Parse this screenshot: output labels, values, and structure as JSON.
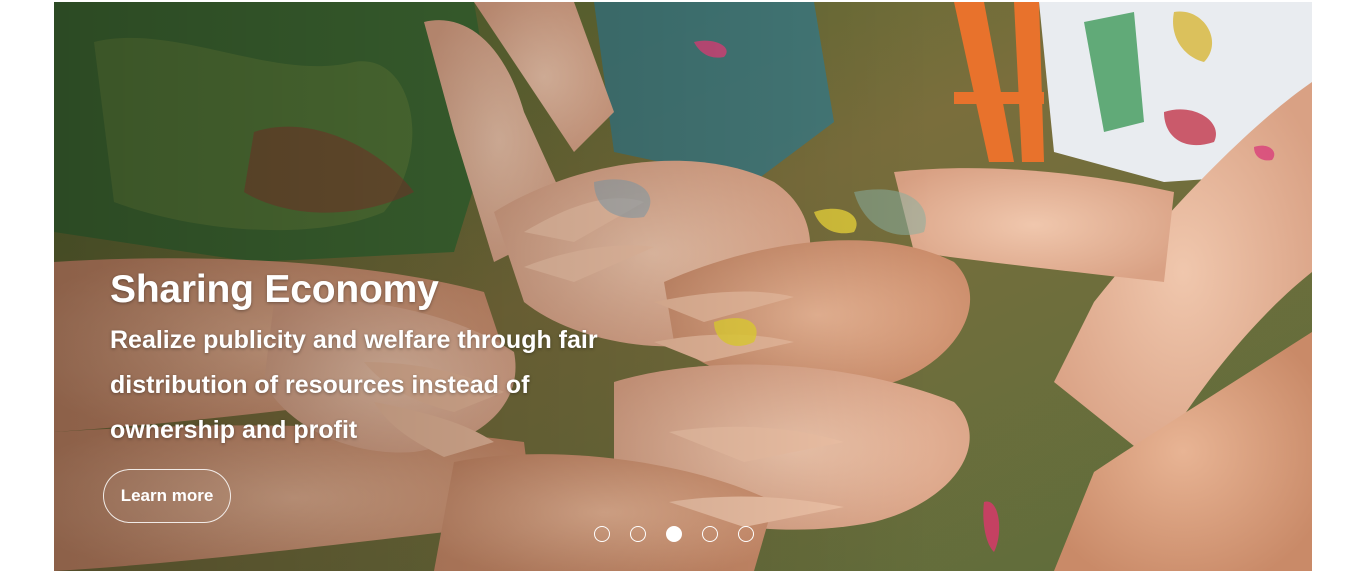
{
  "hero": {
    "title": "Sharing Economy",
    "description": "Realize publicity and welfare through fair distribution of resources instead of ownership and profit",
    "cta_label": "Learn more",
    "background_image": "stacked-paint-covered-hands-photo"
  },
  "carousel": {
    "slide_count": 5,
    "active_index": 2,
    "indicators": [
      "slide-1",
      "slide-2",
      "slide-3",
      "slide-4",
      "slide-5"
    ]
  },
  "colors": {
    "overlay_text": "#ffffff",
    "page_background": "#ffffff"
  }
}
